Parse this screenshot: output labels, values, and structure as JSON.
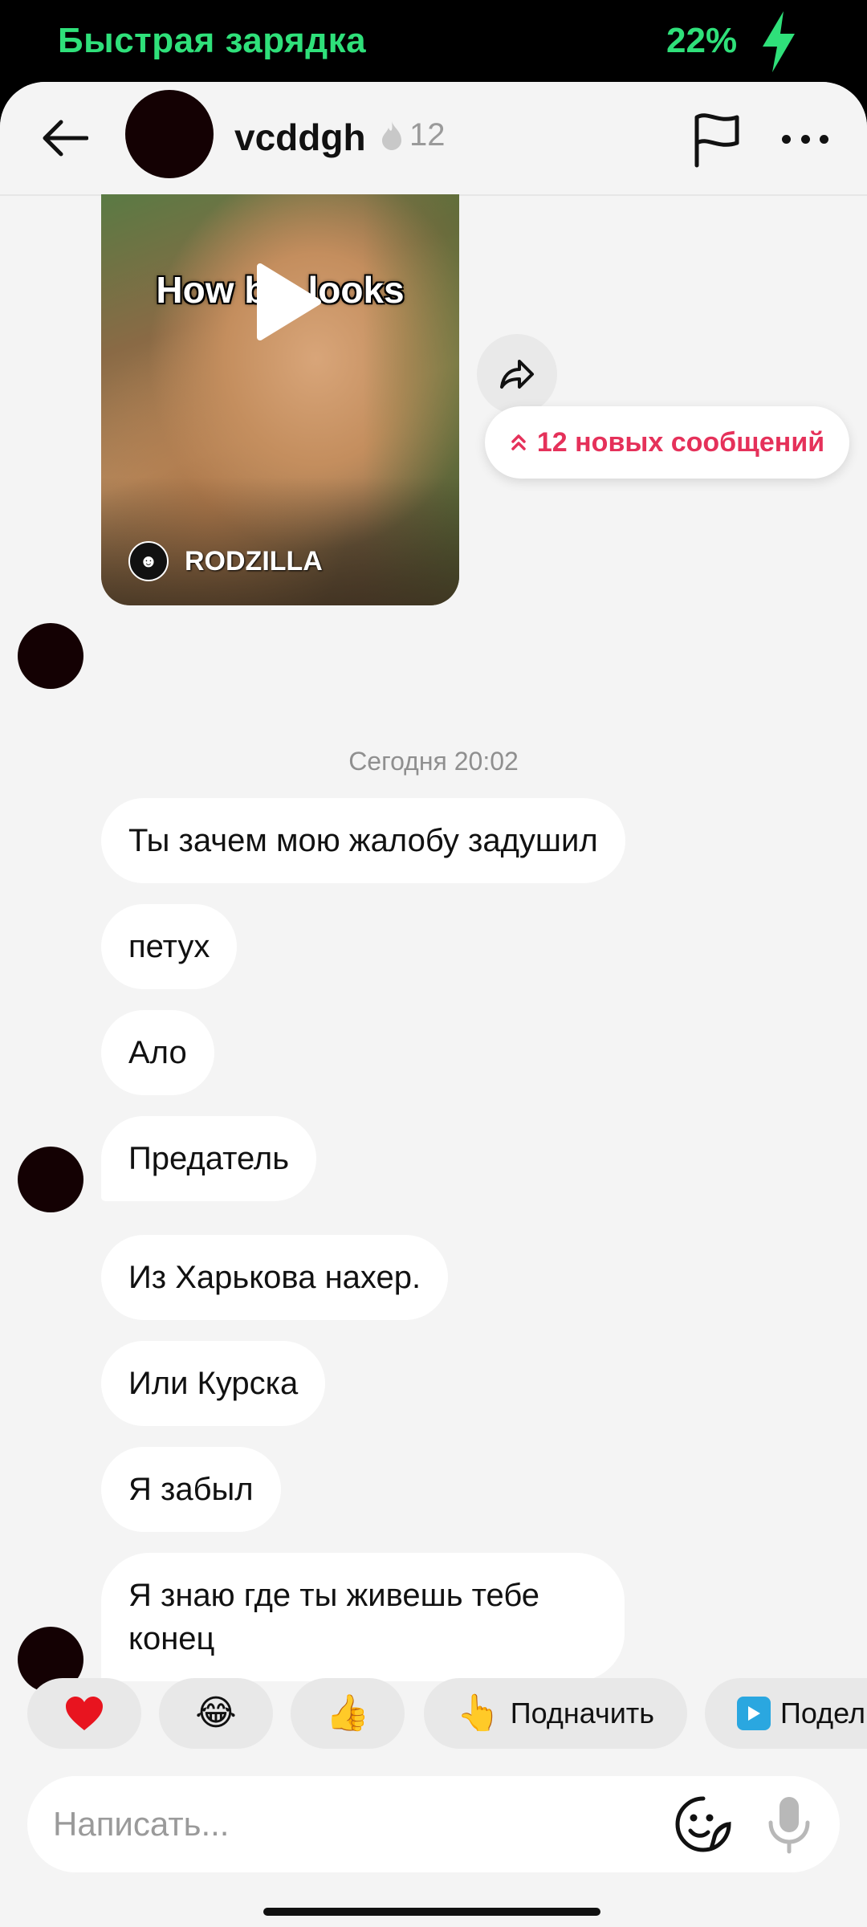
{
  "status_bar": {
    "charging_label": "Быстрая зарядка",
    "battery_percent": "22%",
    "accent_color": "#2fe07a"
  },
  "header": {
    "username": "vcddgh",
    "streak_count": "12",
    "icons": [
      "back-arrow-icon",
      "flame-icon",
      "flag-icon",
      "more-icon"
    ]
  },
  "chat": {
    "video": {
      "title_overlay": "How b    looks",
      "brand": "RODZILLA"
    },
    "new_messages_label": "12 новых сообщений",
    "timestamp": "Сегодня 20:02",
    "messages": [
      {
        "text": "Ты зачем мою жалобу задушил"
      },
      {
        "text": "петух"
      },
      {
        "text": "Ало"
      },
      {
        "text": "Предатель"
      },
      {
        "text": "Из Харькова нахер."
      },
      {
        "text": "Или Курска"
      },
      {
        "text": "Я забыл"
      },
      {
        "text": "Я знаю где ты живешь тебе конец"
      }
    ]
  },
  "quick_reactions": [
    {
      "emoji": "❤️",
      "label": ""
    },
    {
      "emoji": "😂",
      "label": ""
    },
    {
      "emoji": "👍",
      "label": ""
    },
    {
      "emoji": "👆",
      "label": "Подначить"
    },
    {
      "emoji": "▶",
      "label": "Подел"
    }
  ],
  "composer": {
    "placeholder": "Написать...",
    "value": ""
  },
  "colors": {
    "accent_pink": "#e5315a",
    "bubble": "#ffffff",
    "background": "#f4f4f4"
  }
}
